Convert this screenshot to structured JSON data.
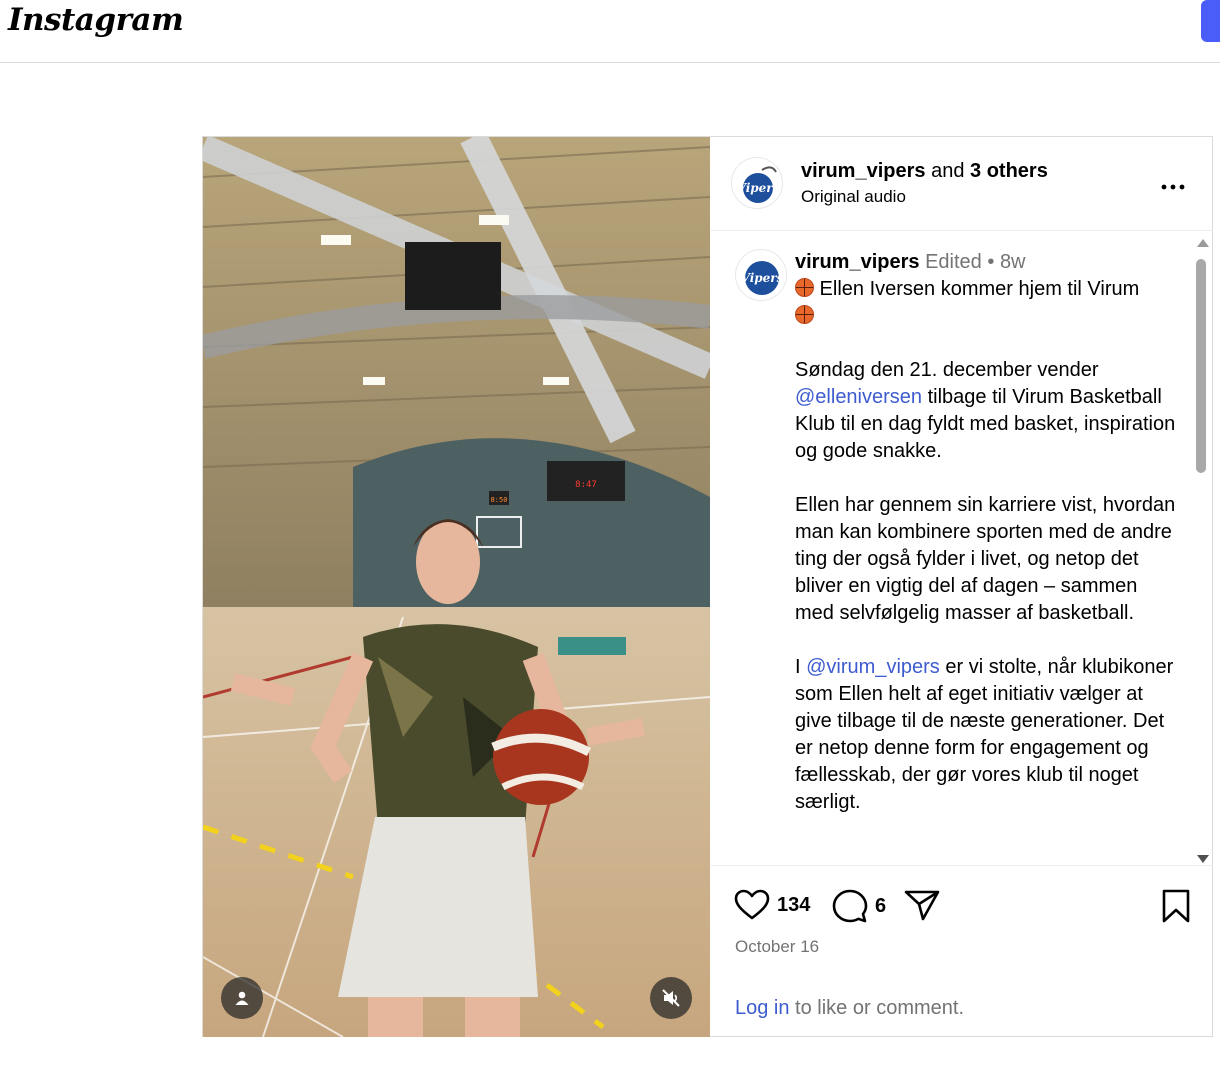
{
  "topbar": {
    "logo": "Instagram"
  },
  "post": {
    "header": {
      "username": "virum_vipers",
      "and_text": "and",
      "others": "3 others",
      "audio": "Original audio"
    },
    "caption": {
      "username": "virum_vipers",
      "edited": "Edited",
      "separator": "•",
      "age": "8w",
      "line1": " Ellen Iversen kommer hjem til Virum",
      "p1_a": "Søndag den 21. december vender ",
      "p1_mention": "@elleniversen",
      "p1_b": " tilbage til Virum Basketball Klub til en dag fyldt med basket, inspiration og gode snakke.",
      "p2": "Ellen har gennem sin karriere vist, hvordan man kan kombinere sporten med de andre ting der også fylder i livet, og netop det bliver en vigtig del af dagen – sammen med selvfølgelig masser af basketball.",
      "p3_a": "I ",
      "p3_mention": "@virum_vipers",
      "p3_b": " er vi stolte, når klubikoner som Ellen helt af eget initiativ vælger at give tilbage til de næste generationer. Det er netop denne form for engagement og fællesskab, der gør vores klub til noget særligt."
    },
    "actions": {
      "likes": "134",
      "comments": "6"
    },
    "date": "October 16",
    "login": {
      "link": "Log in",
      "rest": " to like or comment."
    },
    "media": {
      "scoreboard_left": "8:50",
      "scoreboard_right": "8:47"
    }
  },
  "colors": {
    "link": "#3e5ccf",
    "muted": "#737373",
    "border": "#dbdbdb",
    "accent_button": "#4a5df9"
  },
  "icons": {
    "more": "more-options-icon",
    "like": "heart-icon",
    "comment": "comment-bubble-icon",
    "share": "paper-plane-icon",
    "save": "bookmark-icon",
    "user_tag": "user-tag-icon",
    "mute": "speaker-muted-icon"
  }
}
